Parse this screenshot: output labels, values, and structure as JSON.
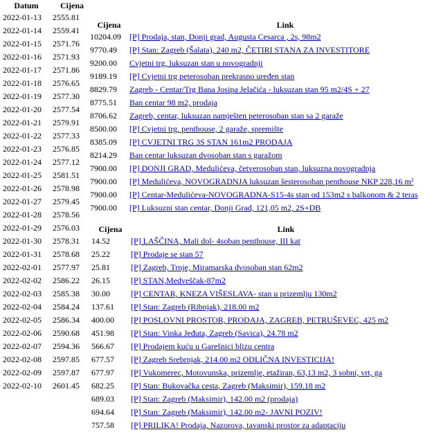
{
  "date_table": {
    "headers": {
      "date": "Datum",
      "price": "Cijena"
    },
    "rows": [
      {
        "date": "2022-01-13",
        "price": "2555.81"
      },
      {
        "date": "2022-01-14",
        "price": "2559.41"
      },
      {
        "date": "2022-01-15",
        "price": "2571.76"
      },
      {
        "date": "2022-01-16",
        "price": "2571.93"
      },
      {
        "date": "2022-01-17",
        "price": "2571.86"
      },
      {
        "date": "2022-01-18",
        "price": "2576.65"
      },
      {
        "date": "2022-01-19",
        "price": "2577.30"
      },
      {
        "date": "2022-01-20",
        "price": "2577.54"
      },
      {
        "date": "2022-01-21",
        "price": "2579.91"
      },
      {
        "date": "2022-01-22",
        "price": "2577.33"
      },
      {
        "date": "2022-01-23",
        "price": "2576.85"
      },
      {
        "date": "2022-01-24",
        "price": "2577.12"
      },
      {
        "date": "2022-01-25",
        "price": "2581.51"
      },
      {
        "date": "2022-01-26",
        "price": "2578.98"
      },
      {
        "date": "2022-01-27",
        "price": "2579.45"
      },
      {
        "date": "2022-01-28",
        "price": "2578.56"
      },
      {
        "date": "2022-01-29",
        "price": "2576.03"
      },
      {
        "date": "2022-01-30",
        "price": "2578.31"
      },
      {
        "date": "2022-01-31",
        "price": "2578.68"
      },
      {
        "date": "2022-02-01",
        "price": "2577.97"
      },
      {
        "date": "2022-02-02",
        "price": "2586.22"
      },
      {
        "date": "2022-02-03",
        "price": "2585.38"
      },
      {
        "date": "2022-02-04",
        "price": "2584.24"
      },
      {
        "date": "2022-02-05",
        "price": "2586.34"
      },
      {
        "date": "2022-02-06",
        "price": "2590.68"
      },
      {
        "date": "2022-02-07",
        "price": "2594.36"
      },
      {
        "date": "2022-02-08",
        "price": "2597.85"
      },
      {
        "date": "2022-02-09",
        "price": "2597.87"
      },
      {
        "date": "2022-02-10",
        "price": "2601.45"
      }
    ]
  },
  "top_listings": {
    "headers": {
      "price": "Cijena",
      "link": "Link"
    },
    "rows": [
      {
        "price": "10204.09",
        "link": "[P] Prodaja, stan, Donji grad, Augusta Cesarca , 2s, 98m2"
      },
      {
        "price": "9770.49",
        "link": "[P] Stan: Zagreb (Šalata), 240 m2, ČETIRI STANA ZA INVESTITORE"
      },
      {
        "price": "9200.00",
        "link": "Cvjetni trg, luksuzan stan u novogradnji"
      },
      {
        "price": "9189.19",
        "link": "[P] Cvjetni trg peterosoban prekrasno uređen stan"
      },
      {
        "price": "8829.79",
        "link": "Zagreb - Centar/Trg Bana Josipa Jelačića - luksuzan stan 95 m2/4S + 27"
      },
      {
        "price": "8775.51",
        "link": "Ban centar 98 m2, prodaja"
      },
      {
        "price": "8706.62",
        "link": "Zagreb, centar, luksuzan namješten peterosoban stan sa 2 garaže"
      },
      {
        "price": "8500.00",
        "link": "[P] Cvjetni trg, penthouse, 2 garaže, spremište"
      },
      {
        "price": "8385.09",
        "link": "[P] CVJETNI TRG 3S STAN 161m2 PRODAJA"
      },
      {
        "price": "8214.29",
        "link": "Ban centar luksuzan dvosoban stan s garažom"
      },
      {
        "price": "7900.00",
        "link": "[P] DONJI GRAD, Medulićeva, četverosoban stan, luksuzna novogradnja"
      },
      {
        "price": "7900.00",
        "link": "[P] Medulićeva, NOVOGRADNJA luksuzan šesterosoban penthouse NKP 228,16 m²"
      },
      {
        "price": "7900.00",
        "link": "[P] Centar-Medulićeva-NOVOGRADNA-S15-4s stan od 153m2 s balkonom & 2 teras"
      },
      {
        "price": "7900.00",
        "link": "[P] Luksuzni stan centar, Donji Grad, 121,05 m2, 2S+DB"
      }
    ]
  },
  "bottom_listings": {
    "headers": {
      "price": "Cijena",
      "link": "Link"
    },
    "rows": [
      {
        "price": "14.52",
        "link": "[P] LAŠČINA, Mali dol- 4soban penthouse, III kat"
      },
      {
        "price": "25.22",
        "link": "[P] Prodaje se stan 57"
      },
      {
        "price": "25.81",
        "link": "[P] Zagreb, Trnje, Miramarska dvosoban stan 62m2"
      },
      {
        "price": "26.15",
        "link": "[P] STAN,Medveščak-87m2"
      },
      {
        "price": "30.00",
        "link": "[P] CENTAR, KNEZA VIŠESLAVA- stan u prizemlju 130m2"
      },
      {
        "price": "137.61",
        "link": "[P] Stan: Zagreb (Ribnjak), 218.00 m2"
      },
      {
        "price": "400.00",
        "link": "[P] POSLOVNI PROSTOR, PRODAJA, ZAGREB, PETRUŠEVEC, 425 m2"
      },
      {
        "price": "451.98",
        "link": "[P] Stan: Vinka Jeđuta, Zagreb (Savica), 24.78 m2"
      },
      {
        "price": "566.67",
        "link": "[P] Prodajem kuću u Garešnici blizu centra"
      },
      {
        "price": "677.57",
        "link": "[P] Zagreb Srebrnjak, 214.00 m2 ODLIČNA INVESTICIJA!"
      },
      {
        "price": "677.97",
        "link": "[P] Vukomerec, Motovunska, prizemlje, etažiran, 63,13 m2, 3 sobni, vrt, ga"
      },
      {
        "price": "682.25",
        "link": "[P] Stan: Bukovačka cesta, Zagreb (Maksimir), 159.18 m2"
      },
      {
        "price": "689.03",
        "link": "[P] Stan: Zagreb (Maksimir), 142.00 m2 (prodaja)"
      },
      {
        "price": "694.64",
        "link": "[P] Stan: Zagreb (Maksimir), 142.00 m2- JAVNI POZIV!"
      },
      {
        "price": "757.58",
        "link": "[P] PRILIKA! Prodaja, Nazorova, tavanski prostor za adaptaciju"
      }
    ]
  }
}
